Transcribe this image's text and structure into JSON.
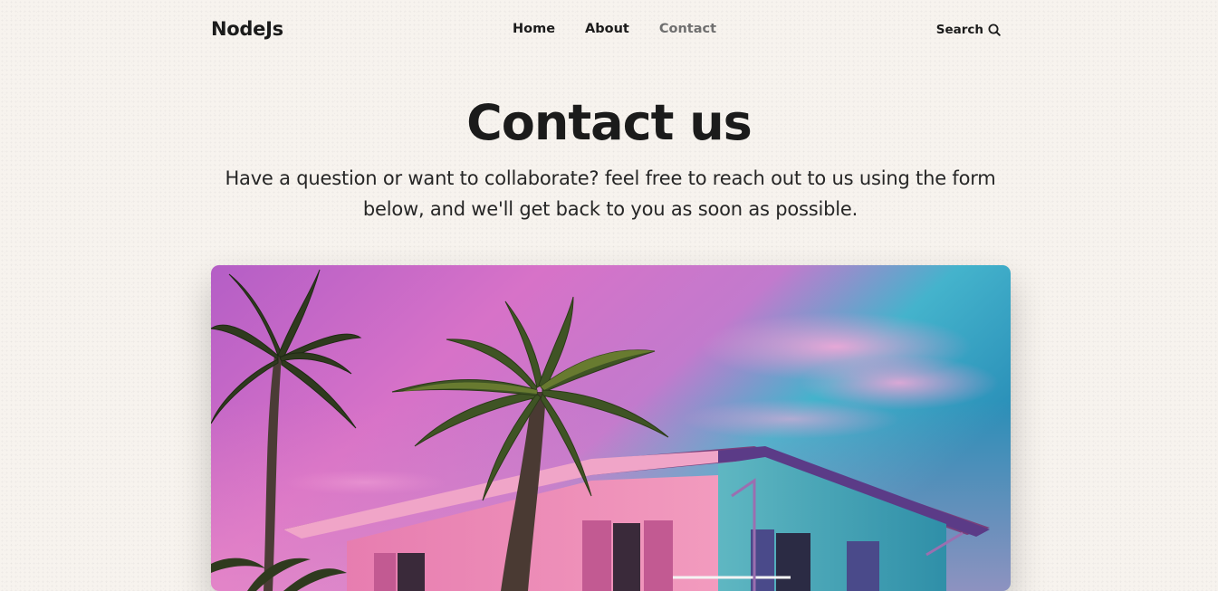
{
  "header": {
    "logo": "NodeJs",
    "nav": [
      {
        "label": "Home",
        "active": false
      },
      {
        "label": "About",
        "active": false
      },
      {
        "label": "Contact",
        "active": true
      }
    ],
    "search_label": "Search",
    "search_icon": "search-icon"
  },
  "hero": {
    "title": "Contact us",
    "subtitle": "Have a question or want to collaborate? feel free to reach out to us using the form below, and we'll get back to you as soon as possible."
  },
  "hero_image": {
    "subject": "palm trees and a pink and teal house under a pink sky",
    "colors": {
      "sky_pink": "#c96ad0",
      "sky_teal": "#2fb0c4",
      "house_pink": "#ee8ab0",
      "house_teal": "#3aa4b4",
      "palm": "#3d4a22"
    }
  },
  "theme": {
    "background": "#f7f3ee",
    "text": "#1b1b1b",
    "nav_active": "#6f6f6f"
  }
}
